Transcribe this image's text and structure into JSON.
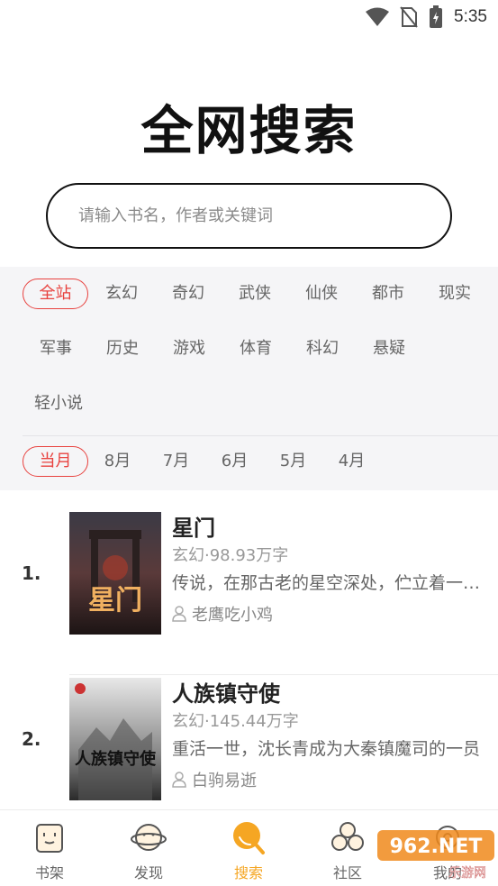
{
  "status_bar": {
    "time": "5:35",
    "icons": [
      "wifi-icon",
      "no-sim-icon",
      "battery-charging-icon"
    ]
  },
  "header": {
    "title": "全网搜索"
  },
  "search": {
    "placeholder": "请输入书名，作者或关键词"
  },
  "categories": {
    "items": [
      "全站",
      "玄幻",
      "奇幻",
      "武侠",
      "仙侠",
      "都市",
      "现实",
      "军事",
      "历史",
      "游戏",
      "体育",
      "科幻",
      "悬疑",
      "轻小说"
    ],
    "selected": "全站"
  },
  "months": {
    "items": [
      "当月",
      "8月",
      "7月",
      "6月",
      "5月",
      "4月"
    ],
    "selected": "当月"
  },
  "books": [
    {
      "rank": "1.",
      "title": "星门",
      "meta": "玄幻·98.93万字",
      "desc": "传说，在那古老的星空深处，伫立着一道血与火侵染的红色之门",
      "author": "老鹰吃小鸡",
      "cover_text": "星门"
    },
    {
      "rank": "2.",
      "title": "人族镇守使",
      "meta": "玄幻·145.44万字",
      "desc": "重活一世，沈长青成为大秦镇魔司的一员",
      "author": "白驹易逝",
      "cover_text": "人族镇守使"
    }
  ],
  "tabbar": {
    "items": [
      {
        "label": "书架",
        "icon": "bookshelf-icon"
      },
      {
        "label": "发现",
        "icon": "discover-icon"
      },
      {
        "label": "搜索",
        "icon": "search-icon"
      },
      {
        "label": "社区",
        "icon": "community-icon"
      },
      {
        "label": "我的",
        "icon": "settings-icon"
      }
    ],
    "active": "搜索"
  },
  "watermark": {
    "text": "962.NET",
    "sub": "乐游网"
  },
  "colors": {
    "accent_red": "#e8423f",
    "accent_orange": "#f5a623"
  }
}
